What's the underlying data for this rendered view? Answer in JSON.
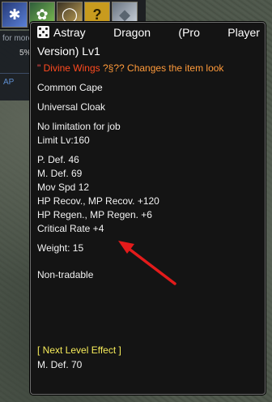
{
  "skillbar": {
    "slots": [
      {
        "icon": "blue-wing-icon"
      },
      {
        "icon": "green-herb-icon"
      },
      {
        "icon": "gold-ring-icon"
      },
      {
        "icon": "question-icon",
        "label": "?"
      },
      {
        "icon": "crystal-icon"
      }
    ]
  },
  "sidepanel": {
    "more_text": "for more",
    "percent": "5%",
    "ap_label": "AP"
  },
  "tooltip": {
    "title_word1": "Astray",
    "title_word2": "Dragon",
    "title_word3": "(Pro",
    "title_word4": "Player",
    "title_line2": "Version) Lv1",
    "desc_quote": "\"",
    "desc_name": "Divine Wings",
    "desc_symbols": "?§??",
    "desc_text": "Changes the item look",
    "type_line": "Common Cape",
    "category_line": "Universal Cloak",
    "job_line": "No limitation for job",
    "level_line": "Limit Lv:160",
    "stats": [
      "P. Def. 46",
      "M. Def. 69",
      "Mov Spd 12",
      "HP Recov., MP Recov. +120",
      "HP Regen., MP Regen. +6",
      "Critical Rate +4"
    ],
    "weight_line": "Weight:  15",
    "trade_line": "Non-tradable",
    "next_level_header": "[ Next Level Effect ]",
    "next_level_stat": "M. Def. 70"
  },
  "colors": {
    "tooltip_bg": "#141414",
    "tooltip_border": "#6f6f6f",
    "name_red": "#ff4a1f",
    "effect_orange": "#ff9a3a",
    "next_level_yellow": "#f7ec5a",
    "annotation_arrow": "#e31b1b"
  }
}
